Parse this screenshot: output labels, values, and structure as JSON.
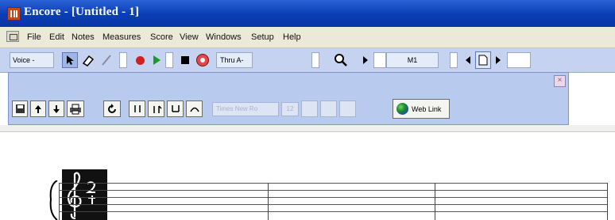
{
  "window": {
    "title": "Encore - [Untitled - 1]"
  },
  "menu": [
    "File",
    "Edit",
    "Notes",
    "Measures",
    "Score",
    "View",
    "Windows",
    "Setup",
    "Help"
  ],
  "toolbar": {
    "voice_label": "Voice -",
    "thru_label": "Thru A-",
    "measure_field": "M1"
  },
  "palette": {
    "close_label": "×",
    "text_field_label": "Times New Ro",
    "size_label": "12",
    "web_link_label": "Web Link"
  },
  "colors": {
    "titlebar": "#0a3db4",
    "toolbar": "#c5d3f0",
    "palette": "#b8caee",
    "record": "#d02020",
    "play": "#1a9a2a"
  },
  "icons": [
    "arrow-pointer-icon",
    "eraser-icon",
    "pencil-icon",
    "record-icon",
    "play-icon",
    "stop-icon",
    "panic-icon",
    "magnifier-icon",
    "page-icon",
    "save-icon",
    "up-arrow-icon",
    "down-arrow-icon",
    "print-icon",
    "rotate-icon",
    "globe-icon",
    "treble-clef-icon"
  ]
}
